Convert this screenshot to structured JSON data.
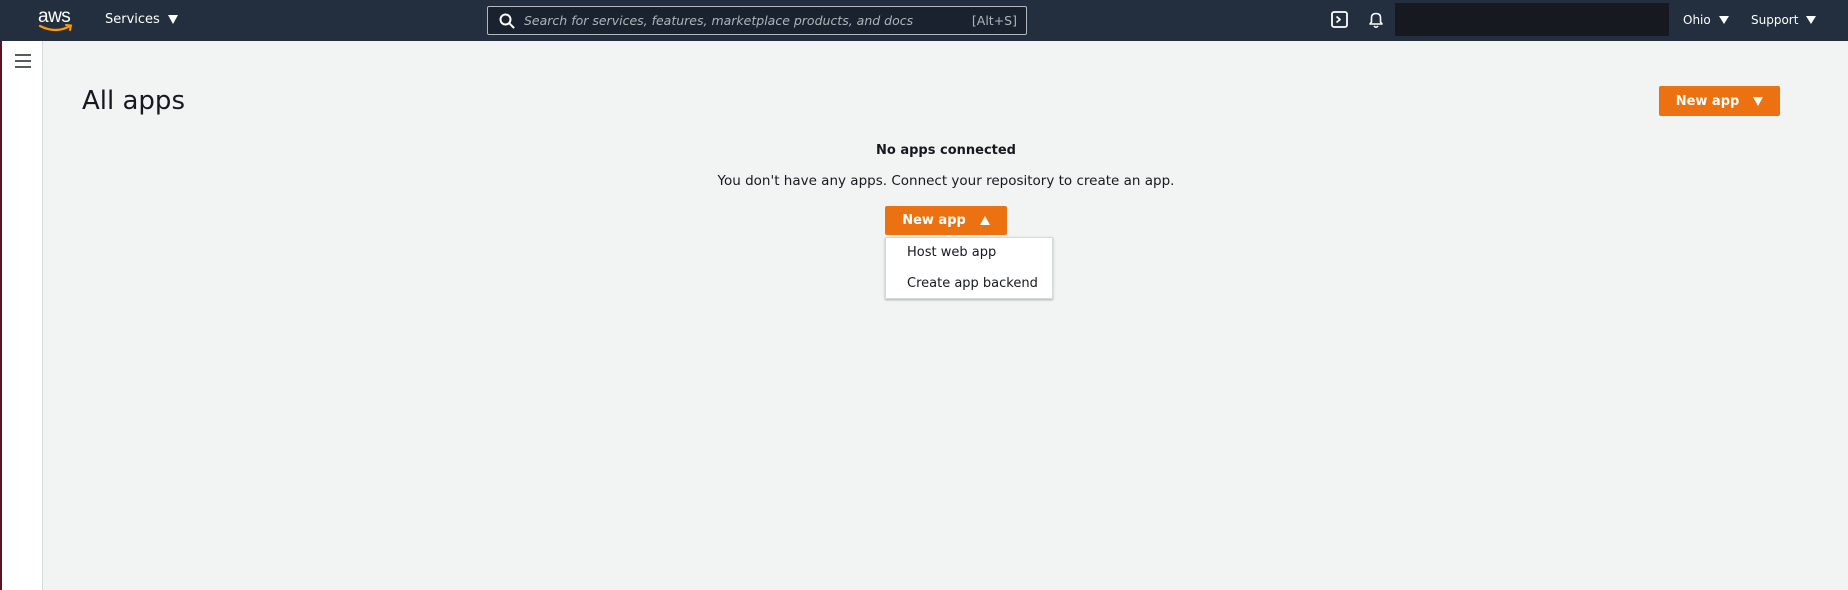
{
  "topbar": {
    "logo_text": "aws",
    "services_label": "Services",
    "search": {
      "placeholder": "Search for services, features, marketplace products, and docs",
      "shortcut": "[Alt+S]"
    },
    "region_label": "Ohio",
    "support_label": "Support",
    "icons": [
      "cloudshell-icon",
      "bell-icon",
      "search-icon"
    ]
  },
  "main": {
    "title": "All apps",
    "header_button_label": "New app",
    "empty_state": {
      "title": "No apps connected",
      "description": "You don't have any apps. Connect your repository to create an app.",
      "button_label": "New app"
    },
    "dropdown_items": [
      "Host web app",
      "Create app backend"
    ]
  },
  "colors": {
    "topbar_bg": "#232f3e",
    "accent_orange": "#ec7211",
    "page_bg": "#f2f3f3"
  }
}
